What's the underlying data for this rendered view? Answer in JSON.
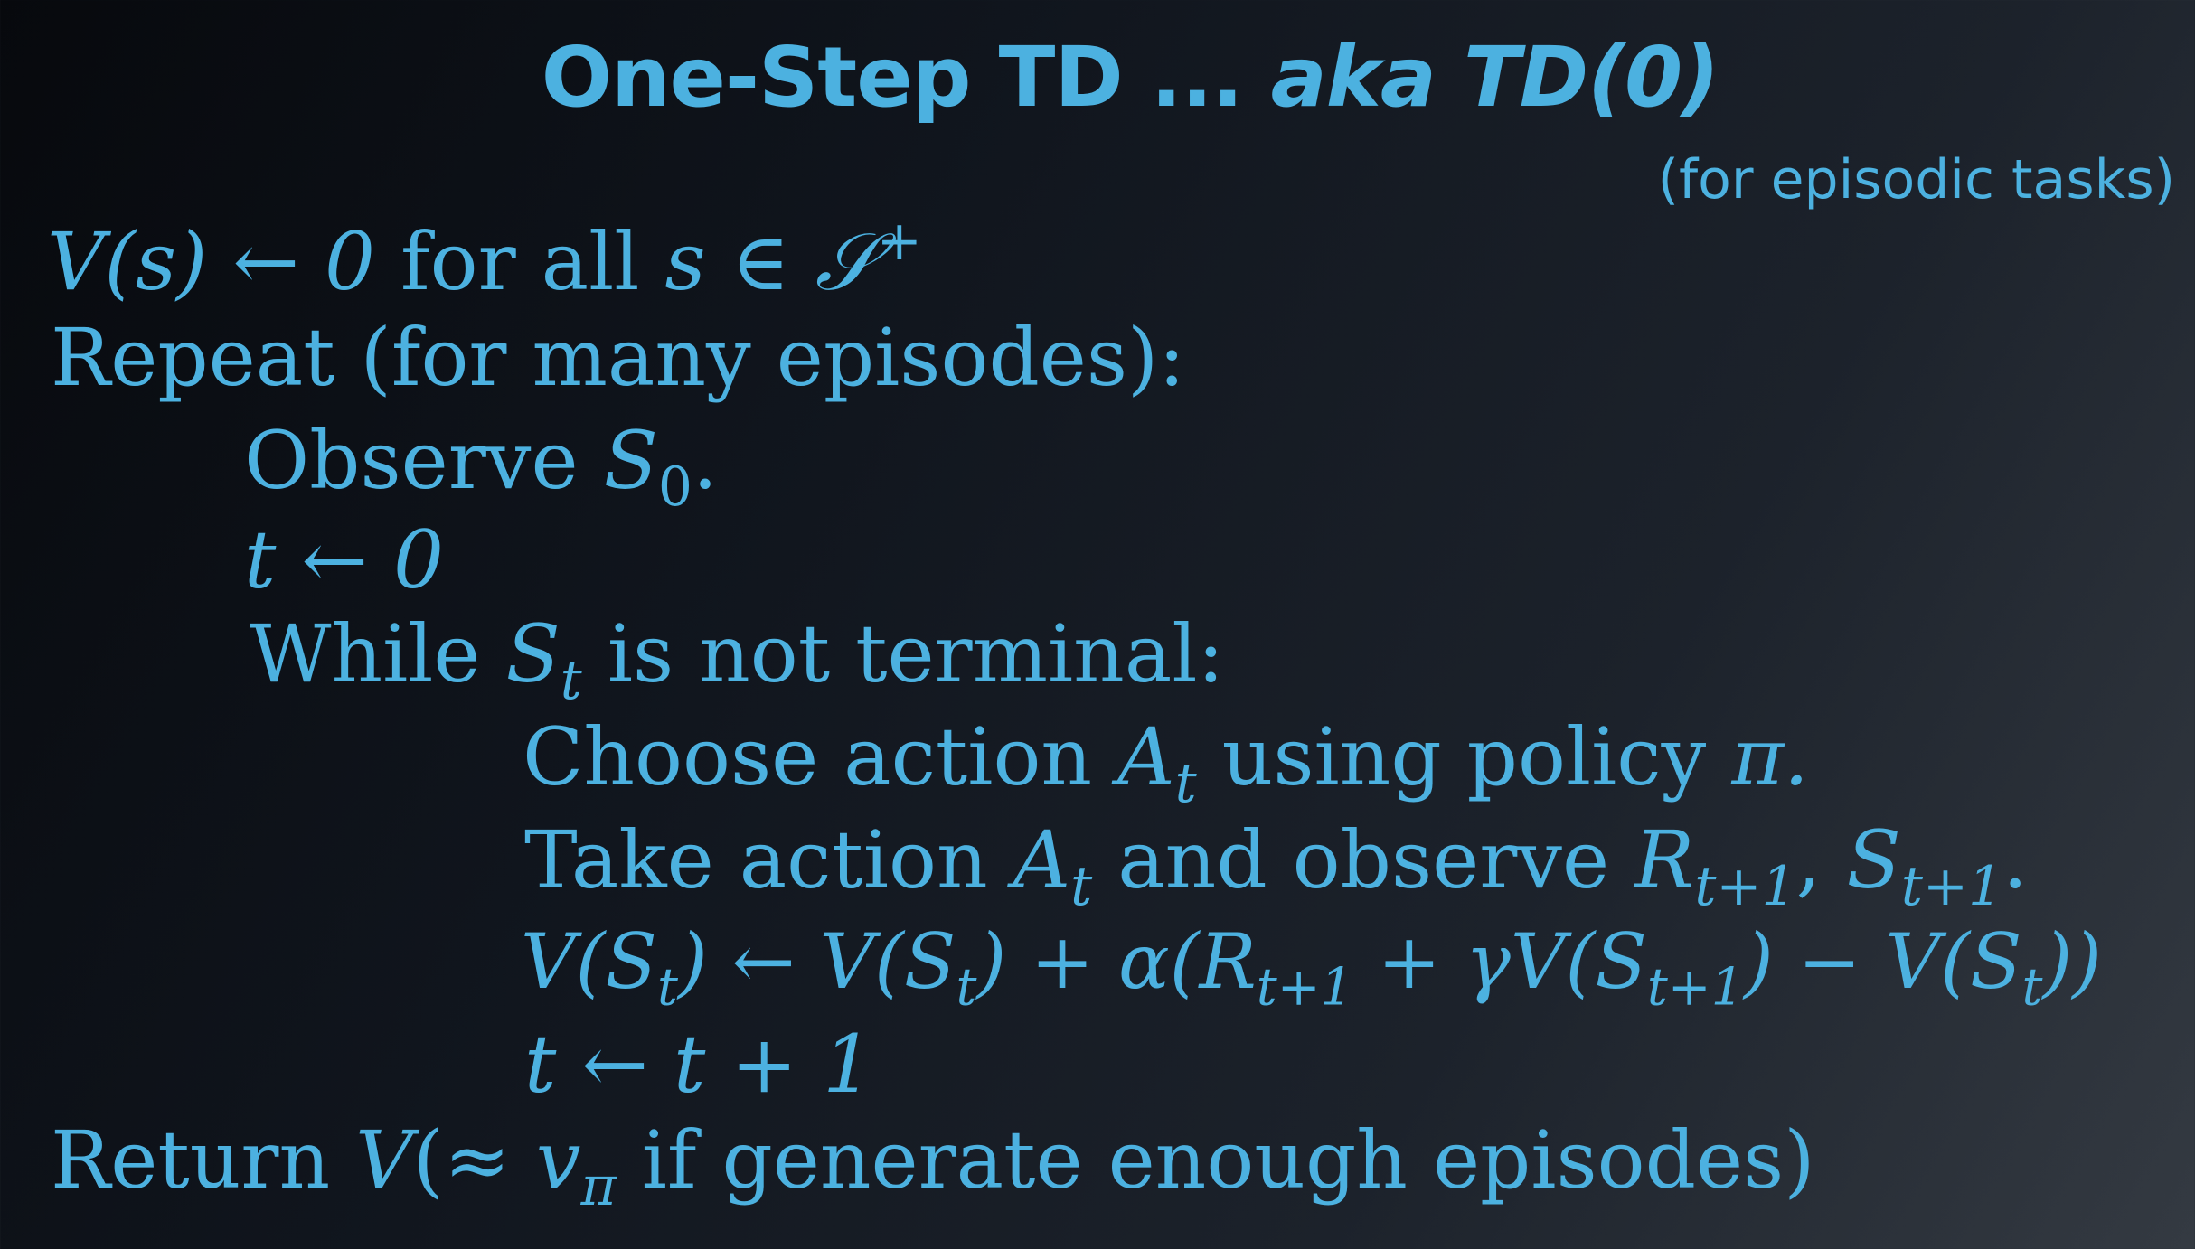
{
  "title": {
    "main": "One-Step TD ...",
    "aka": "aka TD(0)"
  },
  "subtitle": "(for episodic tasks)",
  "colors": {
    "text": "#4cb1e0",
    "background": "#0d1117"
  },
  "algorithm": {
    "init": {
      "lhs": "V(s) ← 0",
      "text": "for all",
      "var": "s ∈ 𝒮",
      "sup": "+"
    },
    "repeat": "Repeat (for many episodes):",
    "observe": {
      "text": "Observe",
      "var": "S",
      "sub": "0",
      "end": "."
    },
    "t_init": "t ← 0",
    "while": {
      "text1": "While",
      "var": "S",
      "sub": "t",
      "text2": "is not terminal:"
    },
    "choose": {
      "text1": "Choose action",
      "var": "A",
      "sub": "t",
      "text2": "using policy",
      "pi": "π."
    },
    "take": {
      "text1": "Take action",
      "var": "A",
      "sub": "t",
      "text2": "and observe",
      "r": "R",
      "rsub": "t+1",
      "comma": ",",
      "s": "S",
      "ssub": "t+1",
      "end": "."
    },
    "update": {
      "p1": "V(S",
      "s1": "t",
      "p2": ") ← V(S",
      "s2": "t",
      "p3": ") + α(R",
      "s3": "t+1",
      "p4": " + γV(S",
      "s4": "t+1",
      "p5": ") − V(S",
      "s5": "t",
      "p6": "))"
    },
    "t_inc": "t ← t + 1",
    "ret": {
      "text1": "Return",
      "v": "V",
      "approx": "(≈",
      "vpi": "v",
      "pisub": "π",
      "text2": "if generate enough episodes)"
    }
  }
}
